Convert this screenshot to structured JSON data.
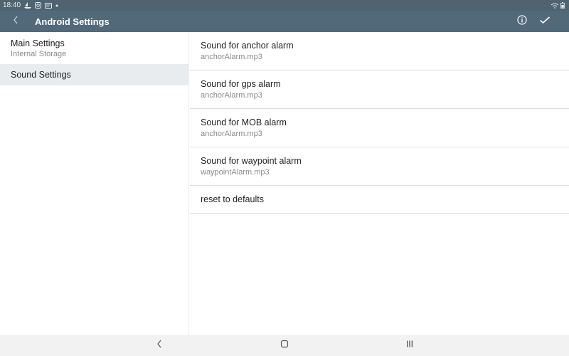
{
  "status_bar": {
    "time": "18:40",
    "icons": [
      "boat-notification-icon",
      "instagram-icon",
      "message-icon",
      "dot-icon"
    ],
    "right_icons": [
      "wifi-icon",
      "battery-icon"
    ]
  },
  "app_bar": {
    "title": "Android Settings",
    "back_icon": "chevron-left-icon",
    "actions": [
      "info-icon",
      "check-icon"
    ]
  },
  "left_pane": {
    "items": [
      {
        "title": "Main Settings",
        "subtitle": "Internal Storage",
        "selected": false
      },
      {
        "title": "Sound Settings",
        "selected": true
      }
    ]
  },
  "right_pane": {
    "items": [
      {
        "title": "Sound for anchor alarm",
        "value": "anchorAlarm.mp3"
      },
      {
        "title": "Sound for gps alarm",
        "value": "anchorAlarm.mp3"
      },
      {
        "title": "Sound for MOB alarm",
        "value": "anchorAlarm.mp3"
      },
      {
        "title": "Sound for waypoint alarm",
        "value": "waypointAlarm.mp3"
      },
      {
        "title": "reset to defaults"
      }
    ]
  },
  "nav_bar": {
    "buttons": [
      "back-icon",
      "home-icon",
      "recents-icon"
    ]
  },
  "colors": {
    "app_bar": "#52697a",
    "status_bar": "#4f6470",
    "selected_item": "#e8ecef"
  }
}
